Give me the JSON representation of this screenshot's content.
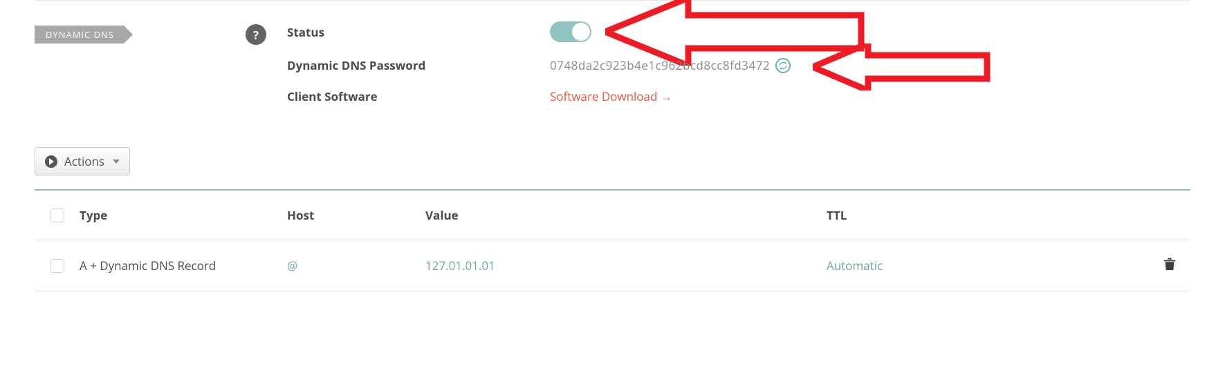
{
  "section_tag": "DYNAMIC DNS",
  "rows": {
    "status_label": "Status",
    "password_label": "Dynamic DNS Password",
    "password_value": "0748da2c923b4e1c962bcd8cc8fd3472",
    "client_label": "Client Software",
    "download_text": "Software Download →"
  },
  "toggle_on": true,
  "actions_button": "Actions",
  "table": {
    "headers": {
      "type": "Type",
      "host": "Host",
      "value": "Value",
      "ttl": "TTL"
    },
    "row": {
      "type": "A + Dynamic DNS Record",
      "host": "@",
      "value": "127.01.01.01",
      "ttl": "Automatic"
    }
  },
  "annotation_color": "#ed1c24"
}
